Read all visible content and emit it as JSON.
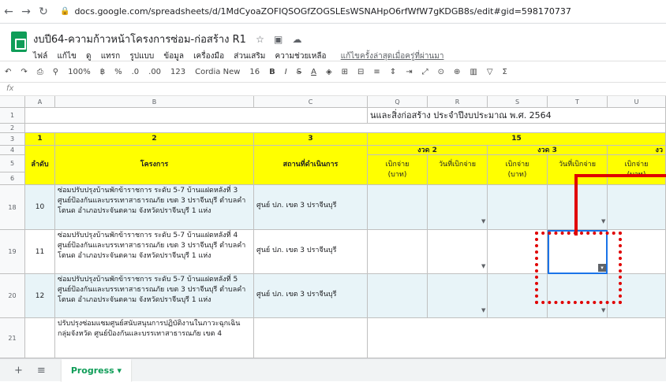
{
  "browser": {
    "url": "docs.google.com/spreadsheets/d/1MdCyoaZOFIQSOGfZOGSLEsWSNAHpO6rfWfW7gKDGB8s/edit#gid=598170737"
  },
  "doc": {
    "title": "งบปี64-ความก้าวหน้าโครงการซ่อม-ก่อสร้าง R1"
  },
  "menus": [
    "ไฟล์",
    "แก้ไข",
    "ดู",
    "แทรก",
    "รูปแบบ",
    "ข้อมูล",
    "เครื่องมือ",
    "ส่วนเสริม",
    "ความช่วยเหลือ"
  ],
  "last_edit": "แก้ไขครั้งล่าสุดเมื่อครู่ที่ผ่านมา",
  "toolbar": {
    "zoom": "100%",
    "currency": "฿",
    "percent": "%",
    "dec0": ".0",
    "dec00": ".00",
    "fmt": "123",
    "font": "Cordia New",
    "size": "16"
  },
  "fx": "fx",
  "columns": [
    "A",
    "B",
    "C",
    "Q",
    "R",
    "S",
    "T",
    "U"
  ],
  "rows_hdr": [
    "1",
    "2",
    "3",
    "4",
    "5",
    "6",
    "18",
    "19",
    "20",
    "21"
  ],
  "banner": "นและสิ่งก่อสร้าง ประจำปีงบประมาณ พ.ศ. 2564",
  "header": {
    "n1": "1",
    "n2": "2",
    "n3": "3",
    "n15": "15",
    "col_a": "ลำดับ",
    "col_b": "โครงการ",
    "col_c": "สถานที่ดำเนินการ",
    "ngod2": "งวด 2",
    "ngod3": "งวด 3",
    "ngod_partial": "งว",
    "pay": "เบิกจ่าย",
    "baht": "(บาท)",
    "date_pay": "วันที่เบิกจ่าย"
  },
  "rows": [
    {
      "no": "10",
      "project": "ซ่อมปรับปรุงบ้านพักข้าราชการ ระดับ 5-7 บ้านแฝดหลังที่ 3 ศูนย์ป้องกันและบรรเทาสาธารณภัย เขต 3 ปราจีนบุรี ตำบลคำโตนด อำเภอประจันตคาม จังหวัดปราจีนบุรี 1 แห่ง",
      "place": "ศูนย์ ปภ. เขต 3 ปราจีนบุรี"
    },
    {
      "no": "11",
      "project": "ซ่อมปรับปรุงบ้านพักข้าราชการ ระดับ 5-7 บ้านแฝดหลังที่ 4 ศูนย์ป้องกันและบรรเทาสาธารณภัย เขต 3 ปราจีนบุรี ตำบลคำโตนด อำเภอประจันตคาม จังหวัดปราจีนบุรี 1 แห่ง",
      "place": "ศูนย์ ปภ. เขต 3 ปราจีนบุรี"
    },
    {
      "no": "12",
      "project": "ซ่อมปรับปรุงบ้านพักข้าราชการ ระดับ 5-7 บ้านแฝดหลังที่ 5 ศูนย์ป้องกันและบรรเทาสาธารณภัย เขต 3 ปราจีนบุรี ตำบลคำโตนด อำเภอประจันตคาม จังหวัดปราจีนบุรี 1 แห่ง",
      "place": "ศูนย์ ปภ. เขต 3 ปราจีนบุรี"
    },
    {
      "no": "",
      "project": "ปรับปรุงซ่อมแซมศูนย์สนับสนุนการปฏิบัติงานในภาวะฉุกเฉินกลุ่มจังหวัด ศูนย์ป้องกันและบรรเทาสาธารณภัย เขต 4",
      "place": ""
    }
  ],
  "sheet": {
    "tab": "Progress ▾"
  }
}
